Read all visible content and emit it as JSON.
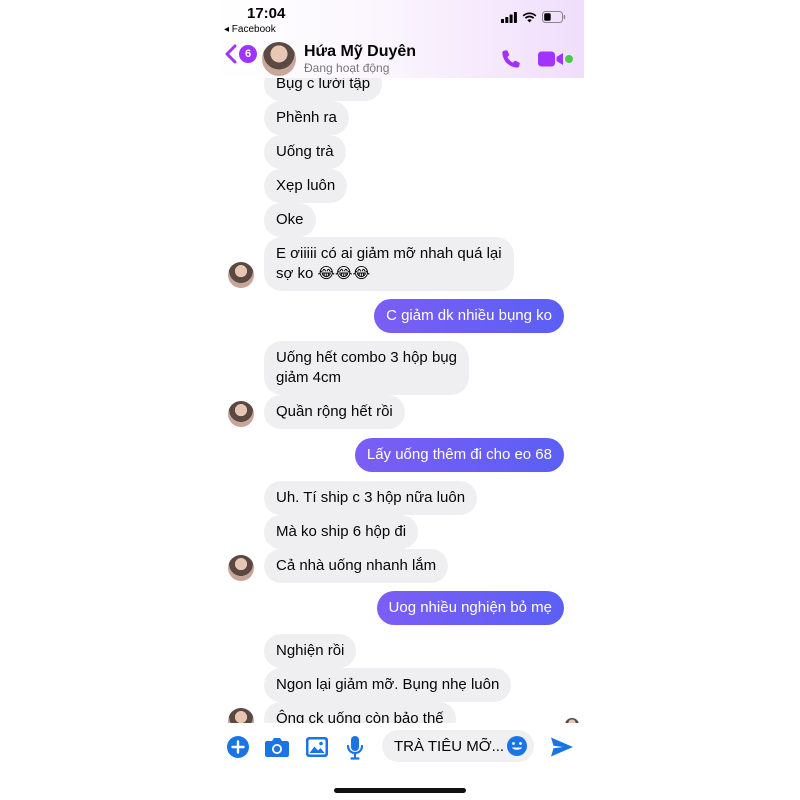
{
  "status_bar": {
    "time": "17:04",
    "back_app": "◂ Facebook"
  },
  "header": {
    "back_count": "6",
    "contact_name": "Hứa Mỹ Duyên",
    "contact_status": "Đang hoạt động",
    "accent_color": "#a033ff"
  },
  "messages": [
    {
      "side": "in",
      "text": "Bụg c lười tập"
    },
    {
      "side": "in",
      "text": "Phềnh ra"
    },
    {
      "side": "in",
      "text": "Uống trà"
    },
    {
      "side": "in",
      "text": "Xẹp luôn"
    },
    {
      "side": "in",
      "text": "Oke"
    },
    {
      "side": "in",
      "line1": "E ơiiiii có ai giảm mỡ nhah quá lại",
      "line2": "sợ ko 😂😂😂"
    },
    {
      "side": "out",
      "text": "C giảm dk nhiều bụng ko"
    },
    {
      "side": "in",
      "line1": "Uống hết combo 3 hộp bụg",
      "line2": "giảm 4cm"
    },
    {
      "side": "in",
      "text": "Quần rộng hết rồi"
    },
    {
      "side": "out",
      "text": "Lấy uống thêm đi cho eo 68"
    },
    {
      "side": "in",
      "text": "Uh. Tí ship c 3 hộp nữa luôn"
    },
    {
      "side": "in",
      "text": "Mà ko ship 6 hộp đi"
    },
    {
      "side": "in",
      "text": "Cả nhà uống nhanh lắm"
    },
    {
      "side": "out",
      "text": "Uog nhiều nghiện bỏ mẹ"
    },
    {
      "side": "in",
      "text": "Nghiện rồi"
    },
    {
      "side": "in",
      "text": "Ngon lại giảm mỡ. Bụng nhẹ luôn"
    },
    {
      "side": "in",
      "text": "Ông ck uống còn bảo thế"
    }
  ],
  "composer": {
    "input_value": "TRÀ TIÊU MỠ..."
  },
  "colors": {
    "outgoing_bubble": "#6a5cf6",
    "incoming_bubble": "#efeff1",
    "icon_blue": "#1b74e4"
  }
}
